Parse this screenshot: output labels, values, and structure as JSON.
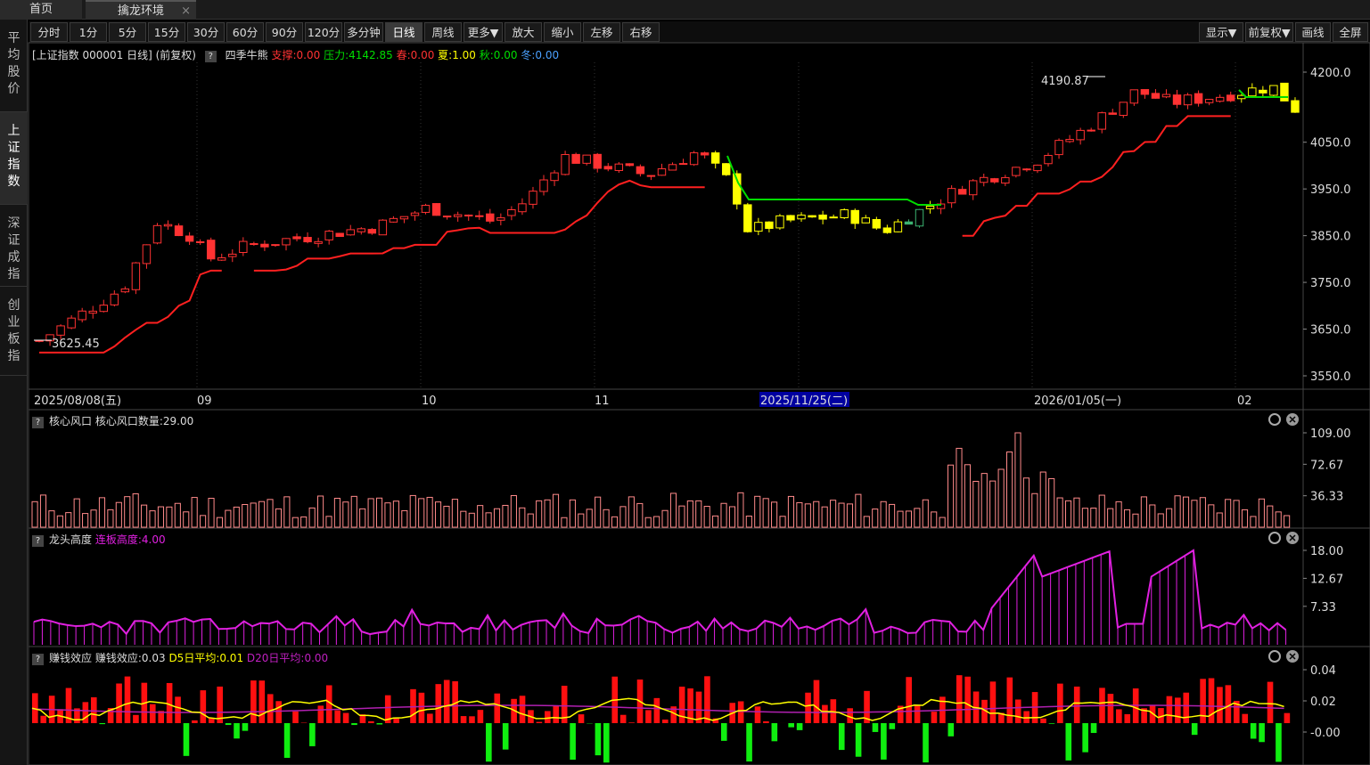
{
  "tabs": {
    "home": "首页",
    "active": "擒龙环境",
    "close": "×"
  },
  "sidebar": [
    {
      "label": "平均股价",
      "active": false
    },
    {
      "label": "上证指数",
      "active": true
    },
    {
      "label": "深证成指",
      "active": false
    },
    {
      "label": "创业板指",
      "active": false
    }
  ],
  "toolbar_left": [
    "分时",
    "1分",
    "5分",
    "15分",
    "30分",
    "60分",
    "90分",
    "120分",
    "多分钟",
    "日线",
    "周线",
    "更多▼",
    "放大",
    "缩小",
    "左移",
    "右移"
  ],
  "toolbar_selected": "日线",
  "toolbar_right": [
    "显示▼",
    "前复权▼",
    "画线",
    "全屏"
  ],
  "main_info": {
    "title": "[上证指数 000001 日线] (前复权)",
    "indicator": "四季牛熊",
    "support": "支撑:0.00",
    "pressure": "压力:4142.85",
    "spring": "春:0.00",
    "summer": "夏:1.00",
    "autumn": "秋:0.00",
    "winter": "冬:0.00",
    "high_label": "4190.87",
    "low_label": "3625.45"
  },
  "main_axis": [
    "4200.0",
    "4050.0",
    "3950.0",
    "3850.0",
    "3750.0",
    "3650.0",
    "3550.0"
  ],
  "date_axis": [
    "2025/08/08(五)",
    "09",
    "10",
    "11",
    "2025/11/25(二)",
    "2026/01/05(一)",
    "02"
  ],
  "panel1": {
    "title": "核心风口",
    "value": "核心风口数量:29.00",
    "axis": [
      "109.00",
      "72.67",
      "36.33"
    ]
  },
  "panel2": {
    "title": "龙头高度",
    "value": "连板高度:4.00",
    "axis": [
      "18.00",
      "12.67",
      "7.33"
    ]
  },
  "panel3": {
    "title": "赚钱效应",
    "value": "赚钱效应:0.03",
    "d5": "D5日平均:0.01",
    "d20": "D20日平均:0.00",
    "axis": [
      "0.04",
      "0.02",
      "-0.00"
    ]
  },
  "colors": {
    "up": "#ff3232",
    "down": "#ff3232",
    "yellow": "#ffff00",
    "green": "#00dd00",
    "magenta": "#e020e0",
    "pink": "#ff9a9a"
  }
}
